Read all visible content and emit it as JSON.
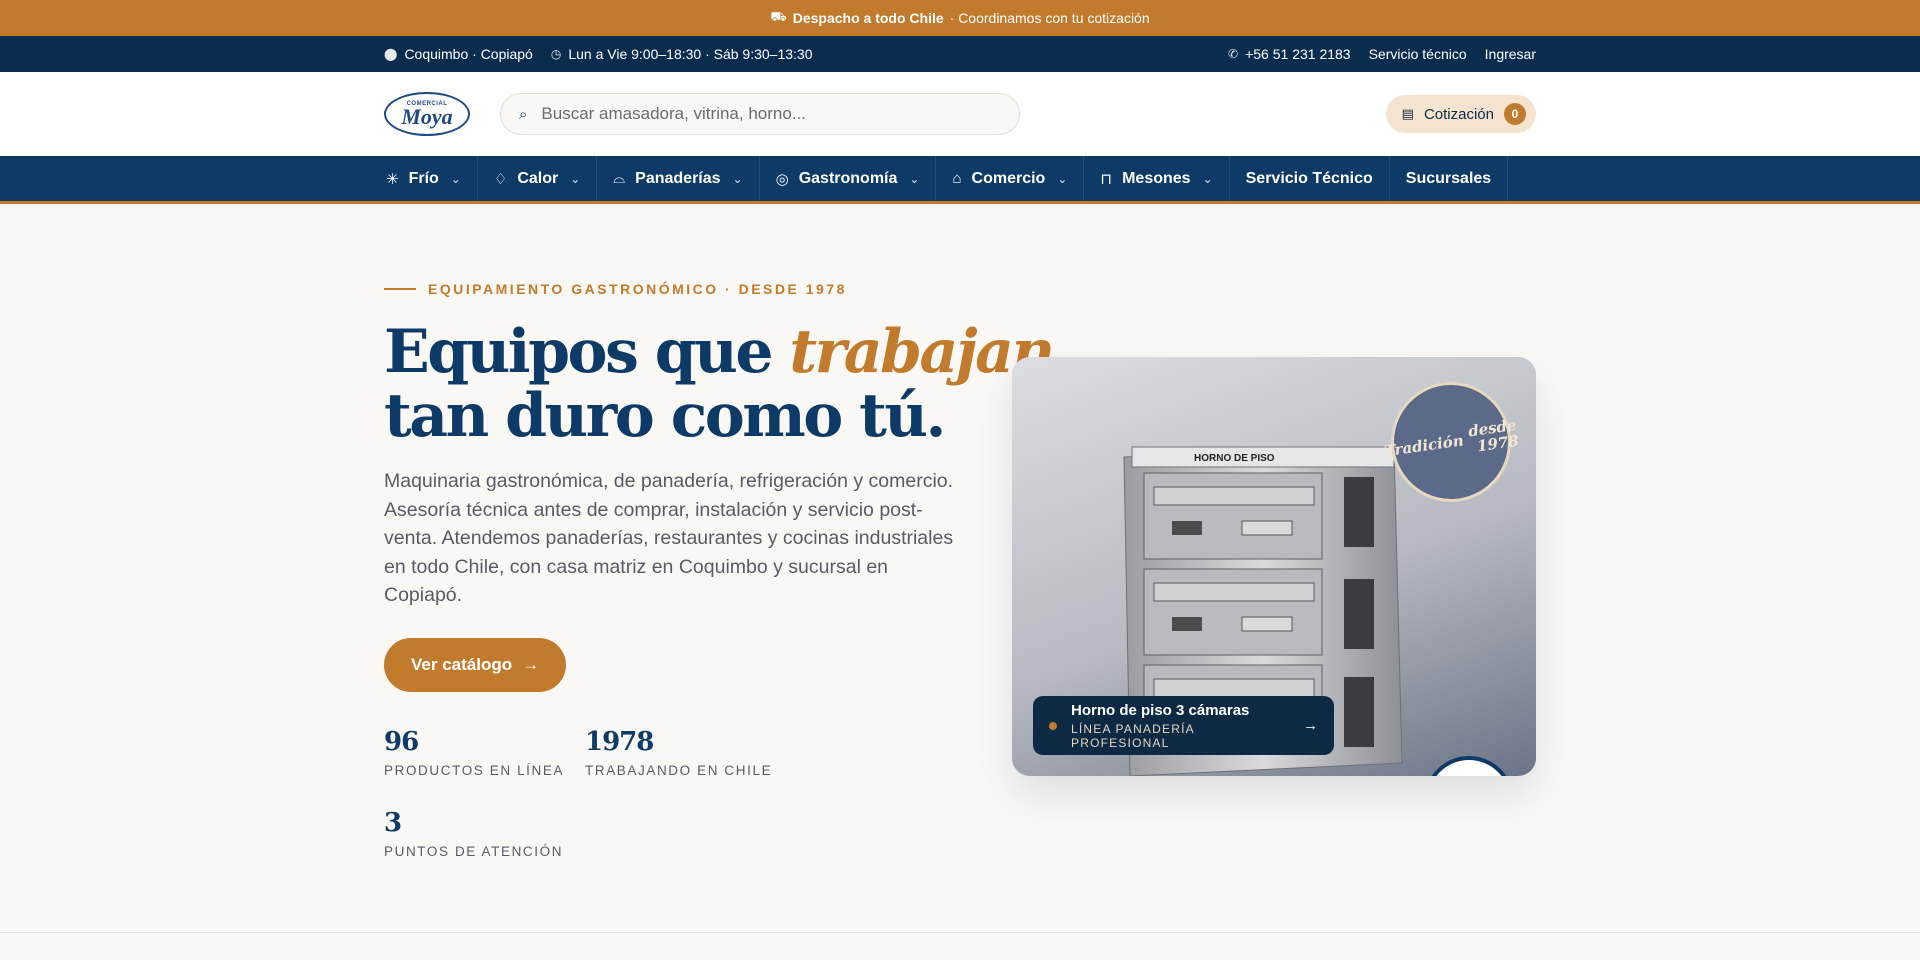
{
  "announcement": {
    "bold": "Despacho a todo Chile",
    "rest": "· Coordinamos con tu cotización"
  },
  "topbar": {
    "location": "Coquimbo · Copiapó",
    "hours": "Lun a Vie 9:00–18:30 · Sáb 9:30–13:30",
    "phone": "+56 51 231 2183",
    "service_link": "Servicio técnico",
    "login_link": "Ingresar"
  },
  "header": {
    "logo_small": "COMERCIAL",
    "logo_big": "Moya",
    "search_placeholder": "Buscar amasadora, vitrina, horno...",
    "quote_label": "Cotización",
    "quote_count": "0"
  },
  "nav": [
    {
      "label": "Frío",
      "icon": "snowflake-icon"
    },
    {
      "label": "Calor",
      "icon": "flame-icon"
    },
    {
      "label": "Panaderías",
      "icon": "bread-icon"
    },
    {
      "label": "Gastronomía",
      "icon": "dish-icon"
    },
    {
      "label": "Comercio",
      "icon": "store-icon"
    },
    {
      "label": "Mesones",
      "icon": "counter-icon"
    },
    {
      "label": "Servicio Técnico"
    },
    {
      "label": "Sucursales"
    }
  ],
  "hero": {
    "eyebrow": "EQUIPAMIENTO GASTRONÓMICO · DESDE 1978",
    "title_line1_a": "Equipos que ",
    "title_line1_em": "trabajan",
    "title_line2": "tan duro como tú.",
    "lead": "Maquinaria gastronómica, de panadería, refrigeración y comercio. Asesoría técnica antes de comprar, instalación y servicio post-venta. Atendemos panaderías, restaurantes y cocinas industriales en todo Chile, con casa matriz en Coquimbo y sucursal en Copiapó.",
    "cta": "Ver catálogo",
    "stats": [
      {
        "num": "96",
        "label": "PRODUCTOS EN LÍNEA"
      },
      {
        "num": "1978",
        "label": "TRABAJANDO EN CHILE"
      },
      {
        "num": "3",
        "label": "PUNTOS DE ATENCIÓN"
      }
    ]
  },
  "product_card": {
    "seal_left": "Tradición",
    "seal_right_1": "desde",
    "seal_right_2": "1978",
    "oven_sign": "HORNO DE PISO",
    "caption_title": "Horno de piso 3 cámaras",
    "caption_sub": "LÍNEA PANADERÍA PROFESIONAL"
  }
}
